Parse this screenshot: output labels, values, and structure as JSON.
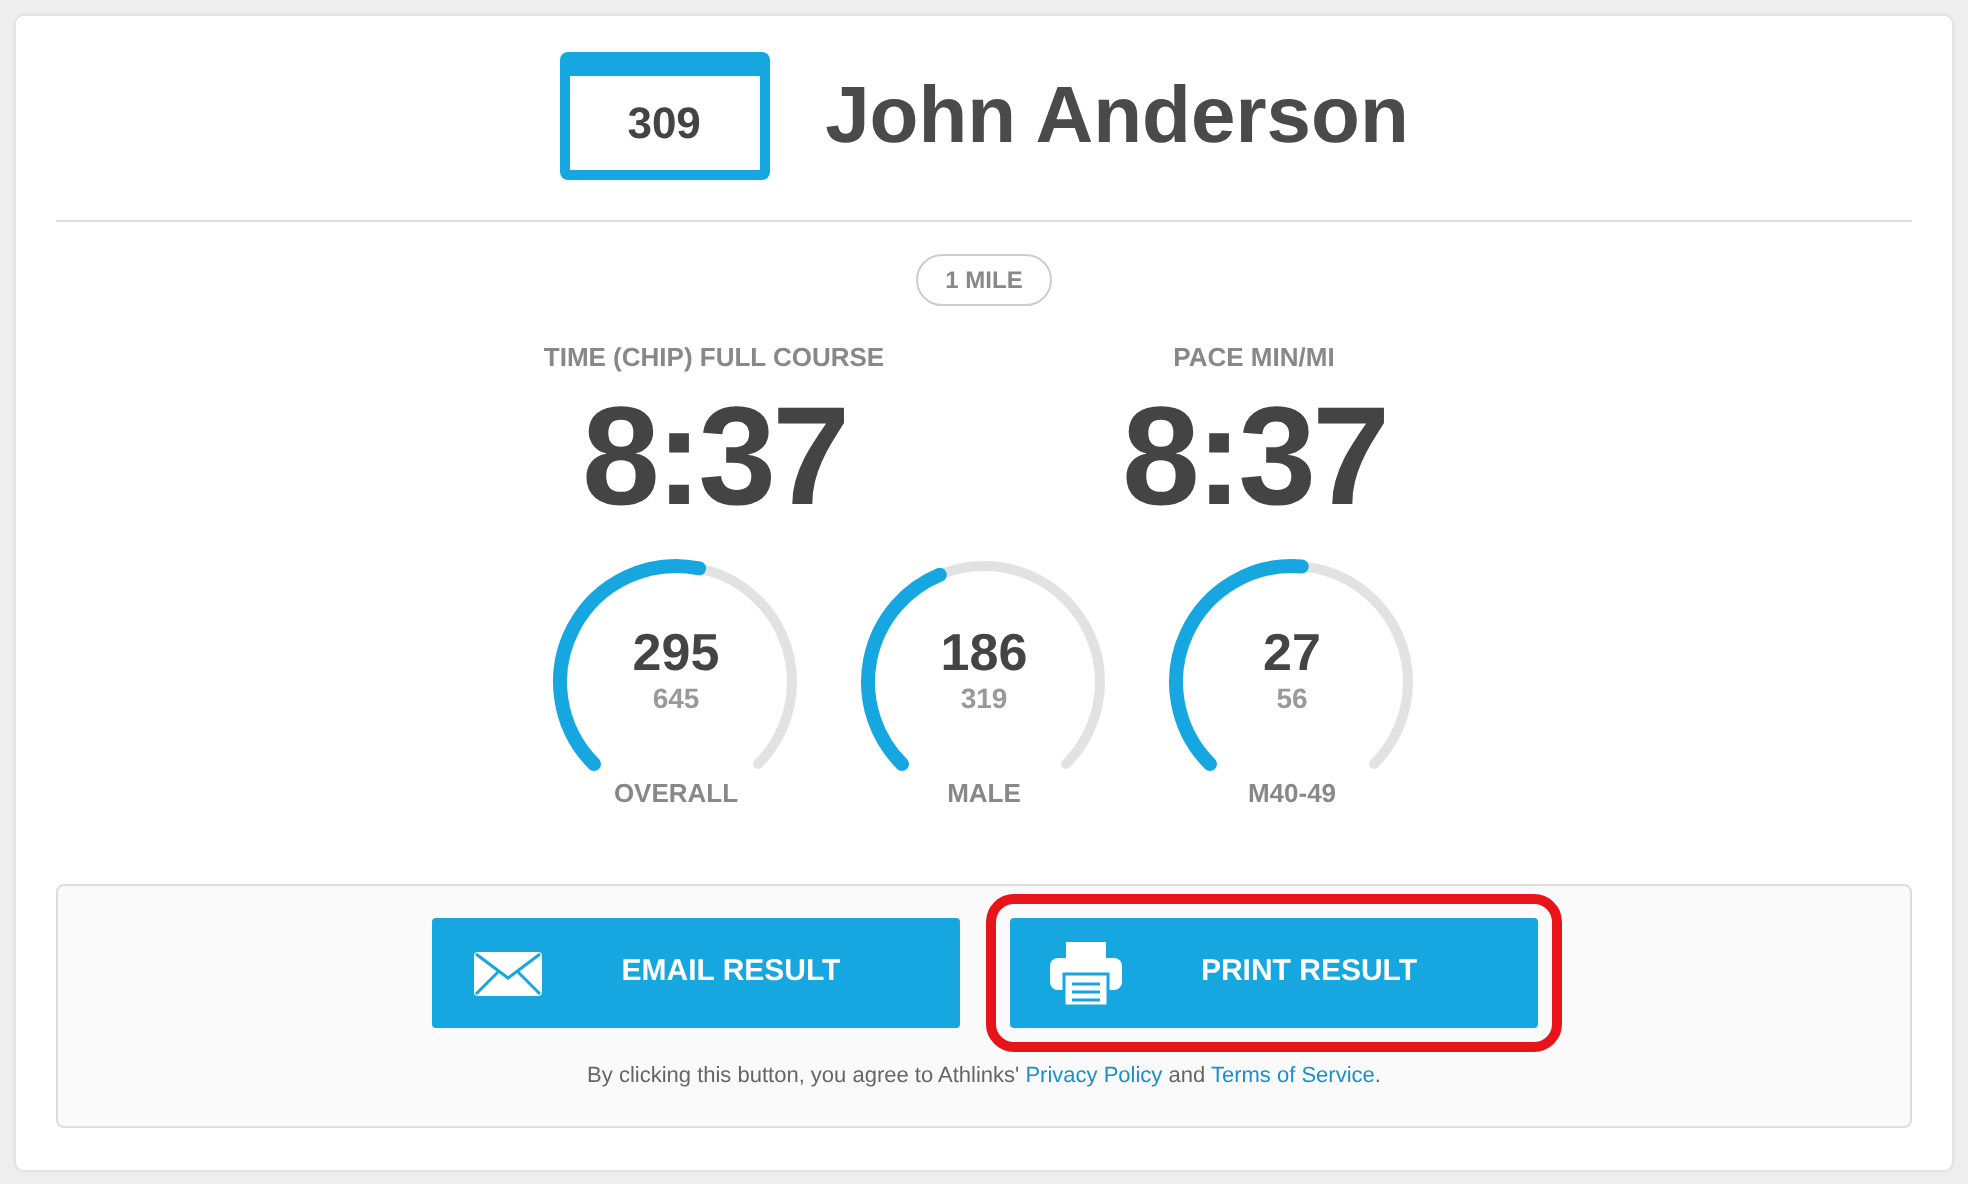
{
  "bib": "309",
  "name": "John Anderson",
  "distance": "1 MILE",
  "stats": [
    {
      "label": "TIME (CHIP) FULL COURSE",
      "value": "8:37"
    },
    {
      "label": "PACE MIN/MI",
      "value": "8:37"
    }
  ],
  "rankings": [
    {
      "rank": "295",
      "total": "645",
      "label": "OVERALL"
    },
    {
      "rank": "186",
      "total": "319",
      "label": "MALE"
    },
    {
      "rank": "27",
      "total": "56",
      "label": "M40-49"
    }
  ],
  "buttons": [
    {
      "kind": "email",
      "label": "EMAIL RESULT",
      "highlighted": false
    },
    {
      "kind": "print",
      "label": "PRINT RESULT",
      "highlighted": true
    }
  ],
  "disclaimer": {
    "text": "By clicking this button, you agree to Athlinks'",
    "link_1": "Privacy Policy",
    "joiner": "and",
    "link_2": "Terms of Service",
    "end": "."
  }
}
